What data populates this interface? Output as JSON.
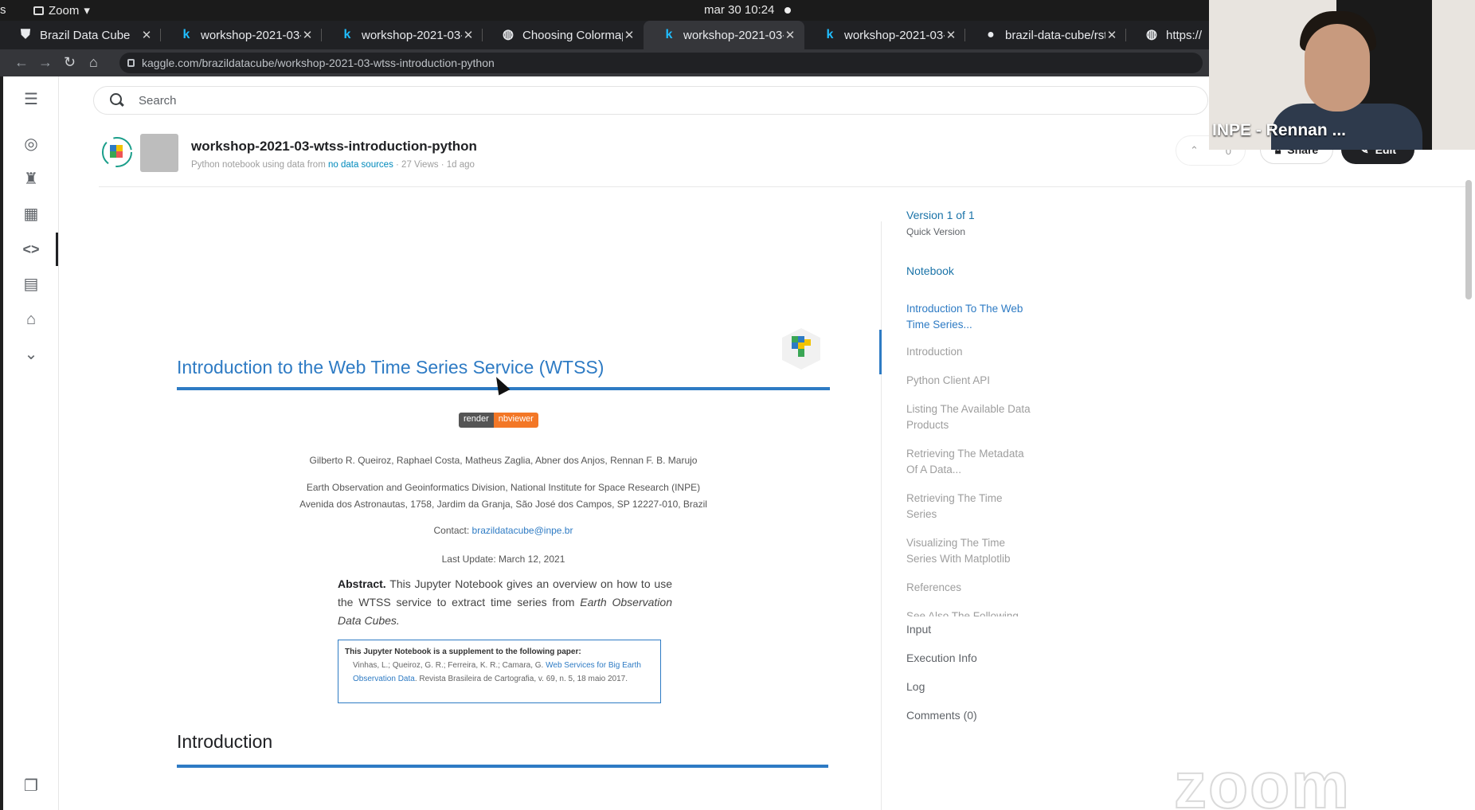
{
  "os_bar": {
    "edge_char": "s",
    "app_name": "Zoom",
    "datetime": "mar 30  10:24"
  },
  "tabs": [
    {
      "title": "Brazil Data Cube",
      "favicon": "shield-icon"
    },
    {
      "title": "workshop-2021-03-",
      "favicon": "kaggle-k-icon"
    },
    {
      "title": "workshop-2021-03-",
      "favicon": "kaggle-k-icon"
    },
    {
      "title": "Choosing Colormap",
      "favicon": "globe-icon"
    },
    {
      "title": "workshop-2021-03-",
      "favicon": "kaggle-k-icon",
      "active": true
    },
    {
      "title": "workshop-2021-03-",
      "favicon": "kaggle-k-icon"
    },
    {
      "title": "brazil-data-cube/rst",
      "favicon": "github-icon"
    },
    {
      "title": "https://",
      "favicon": "globe-icon"
    }
  ],
  "address_bar": {
    "url": "kaggle.com/brazildatacube/workshop-2021-03-wtss-introduction-python"
  },
  "search": {
    "placeholder": "Search"
  },
  "notebook_header": {
    "title": "workshop-2021-03-wtss-introduction-python",
    "meta_prefix": "Python notebook using data from",
    "meta_link": "no data sources",
    "meta_suffix": "· 27 Views · 1d ago",
    "votes": "0",
    "share_label": "Share",
    "edit_label": "Edit"
  },
  "notebook": {
    "heading": "Introduction to the Web Time Series Service (WTSS)",
    "badge_left": "render",
    "badge_right": "nbviewer",
    "authors": "Gilberto R. Queiroz, Raphael Costa, Matheus Zaglia, Abner dos Anjos, Rennan F. B. Marujo",
    "affiliation_line1": "Earth Observation and Geoinformatics Division, National Institute for Space Research (INPE)",
    "affiliation_line2": "Avenida dos Astronautas, 1758, Jardim da Granja, São José dos Campos, SP 12227-010, Brazil",
    "contact_label": "Contact:",
    "contact_email": "brazildatacube@inpe.br",
    "last_update": "Last Update: March 12, 2021",
    "abstract_label": "Abstract.",
    "abstract_text": "This Jupyter Notebook gives an overview on how to use the WTSS service to extract time series from",
    "abstract_italic": "Earth Observation Data Cubes.",
    "paper_title": "This Jupyter Notebook is a supplement to the following paper:",
    "paper_authors": "Vinhas, L.; Queiroz, G. R.; Ferreira, K. R.; Camara, G.",
    "paper_link": "Web Services for Big Earth Observation Data",
    "paper_rest": ". Revista Brasileira de Cartografia, v. 69, n. 5, 18 maio 2017.",
    "section_heading": "Introduction"
  },
  "toc": {
    "version": "Version 1 of 1",
    "version_sub": "Quick Version",
    "notebook_label": "Notebook",
    "items": [
      "Introduction To The Web Time Series...",
      "Introduction",
      "Python Client API",
      "Listing The Available Data Products",
      "Retrieving The Metadata Of A Data...",
      "Retrieving The Time Series",
      "Visualizing The Time Series With Matplotlib",
      "References",
      "See Also The Following"
    ],
    "sections": [
      "Input",
      "Execution Info",
      "Log",
      "Comments (0)"
    ]
  },
  "video": {
    "participant_name": "INPE - Rennan ..."
  },
  "watermark": "zoom",
  "colors": {
    "accent": "#2e7bc4",
    "kaggle_blue": "#20beff",
    "nbviewer_orange": "#f37726"
  }
}
